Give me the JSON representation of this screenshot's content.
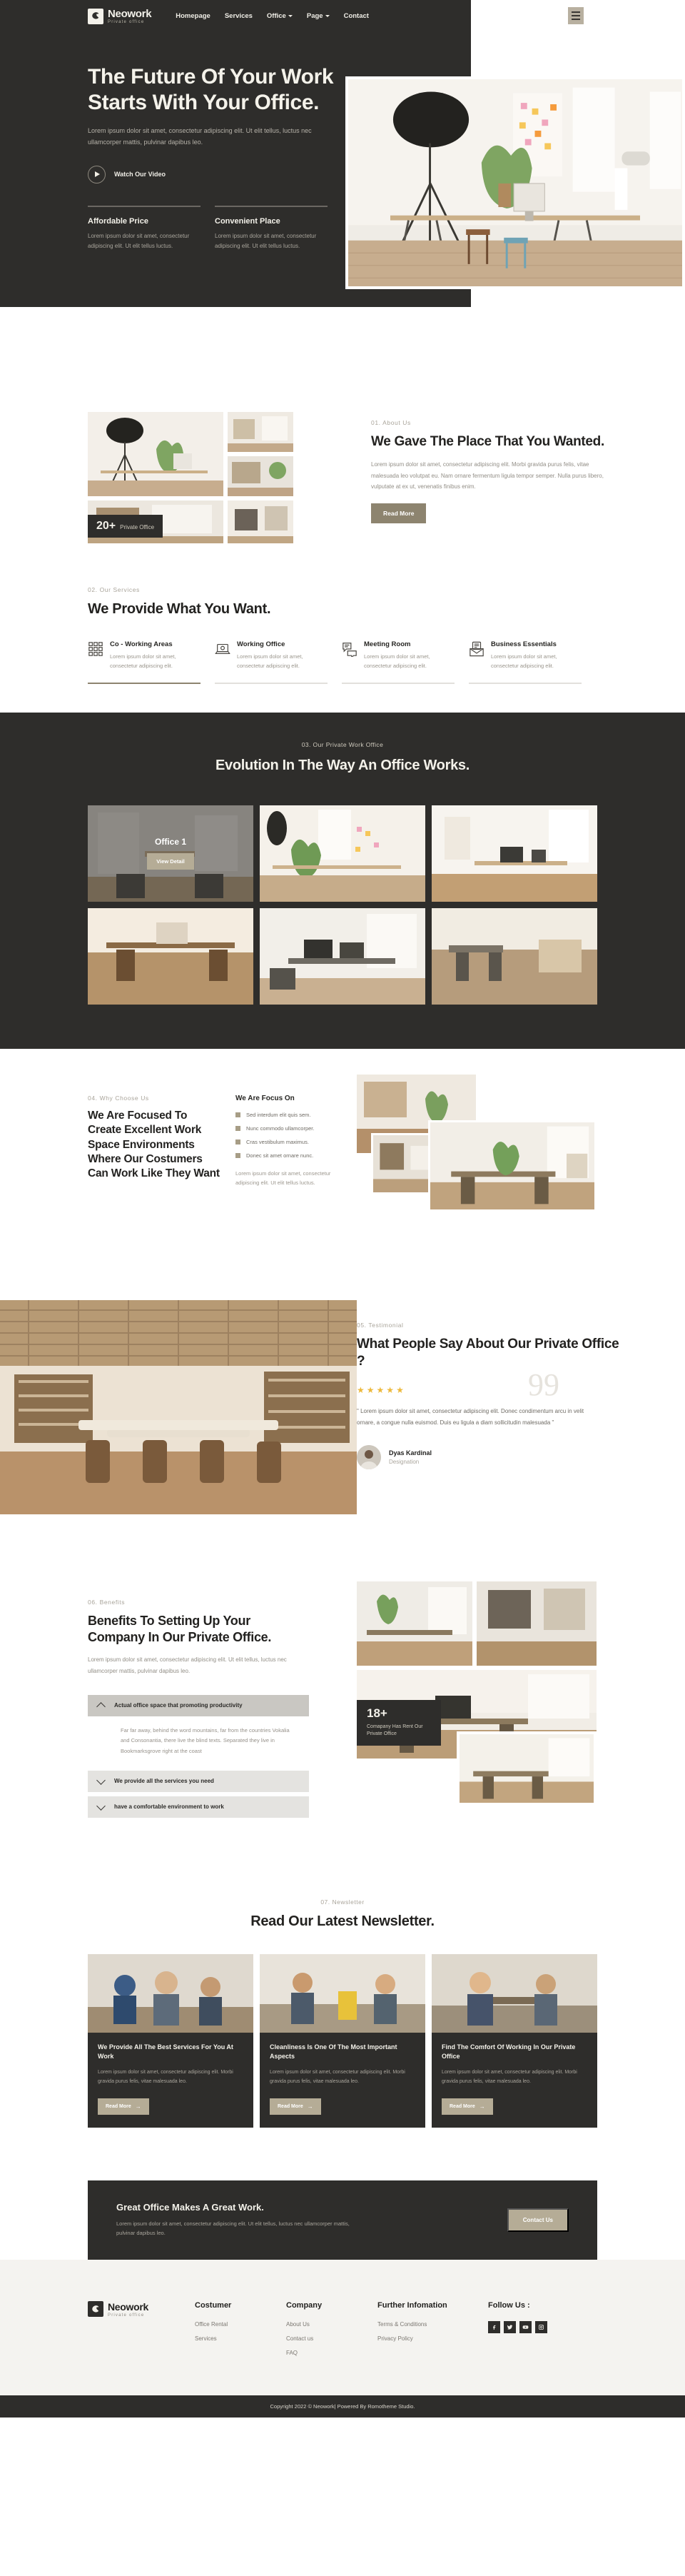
{
  "brand": {
    "name": "Neowork",
    "tagline": "Private office"
  },
  "nav": {
    "items": [
      {
        "label": "Homepage",
        "caret": false
      },
      {
        "label": "Services",
        "caret": false
      },
      {
        "label": "Office",
        "caret": true
      },
      {
        "label": "Page",
        "caret": true
      },
      {
        "label": "Contact",
        "caret": false
      }
    ],
    "menu_icon": "hamburger-icon"
  },
  "hero": {
    "heading_line1": "The Future Of Your Work",
    "heading_line2": "Starts With Your Office.",
    "paragraph": "Lorem ipsum dolor sit amet, consectetur adipiscing elit. Ut elit tellus, luctus nec ullamcorper mattis, pulvinar dapibus leo.",
    "watch_label": "Watch Our Video",
    "features": [
      {
        "title": "Affordable Price",
        "text": "Lorem ipsum dolor sit amet, consectetur adipiscing elit. Ut elit tellus luctus."
      },
      {
        "title": "Convenient Place",
        "text": "Lorem ipsum dolor sit amet, consectetur adipiscing elit. Ut elit tellus luctus."
      }
    ]
  },
  "about": {
    "eyebrow": "01. About Us",
    "heading": "We Gave The Place That You Wanted.",
    "paragraph": "Lorem ipsum dolor sit amet, consectetur adipiscing elit. Morbi gravida purus felis, vitae malesuada leo volutpat eu. Nam ornare fermentum ligula tempor semper. Nulla purus libero, vulputate at ex ut, venenatis finibus enim.",
    "button": "Read More",
    "badge_number": "20+",
    "badge_label": "Private Office"
  },
  "services": {
    "eyebrow": "02. Our Services",
    "heading": "We Provide What You Want.",
    "items": [
      {
        "title": "Co - Working Areas",
        "text": "Lorem ipsum dolor sit amet, consectetur adipiscing elit.",
        "icon": "grid-squares-icon"
      },
      {
        "title": "Working Office",
        "text": "Lorem ipsum dolor sit amet, consectetur adipiscing elit.",
        "icon": "laptop-icon"
      },
      {
        "title": "Meeting Room",
        "text": "Lorem ipsum dolor sit amet, consectetur adipiscing elit.",
        "icon": "chat-bubbles-icon"
      },
      {
        "title": "Business Essentials",
        "text": "Lorem ipsum dolor sit amet, consectetur adipiscing elit.",
        "icon": "envelope-icon"
      }
    ]
  },
  "gallery": {
    "eyebrow": "03. Our Private Work Office",
    "heading": "Evolution In The Way An Office Works.",
    "active_title": "Office 1",
    "active_button": "View Detail"
  },
  "why": {
    "eyebrow": "04. Why Choose Us",
    "heading": "We Are Focused To Create Excellent Work Space Environments Where Our Costumers Can Work Like They Want",
    "focus_title": "We Are Focus On",
    "focus_items": [
      "Sed interdum elit quis sem.",
      "Nunc commodo ullamcorper.",
      "Cras vestibulum maximus.",
      "Donec sit amet ornare nunc."
    ],
    "note": "Lorem ipsum dolor sit amet, consectetur adipiscing elit. Ut elit tellus luctus."
  },
  "testimonial": {
    "eyebrow": "05. Testimonial",
    "heading": "What People Say About Our Private Office ?",
    "rating": 5,
    "quote": "\" Lorem ipsum dolor sit amet, consectetur adipiscing elit. Donec condimentum arcu in velit ornare, a congue nulla euismod. Duis eu ligula a diam sollicitudin malesuada \"",
    "author_name": "Dyas Kardinal",
    "author_role": "Designation",
    "quote_mark": "99"
  },
  "benefits": {
    "eyebrow": "06. Benefits",
    "heading": "Benefits To Setting Up Your Company In Our Private Office.",
    "paragraph": "Lorem ipsum dolor sit amet, consectetur adipiscing elit. Ut elit tellus, luctus nec ullamcorper mattis, pulvinar dapibus leo.",
    "accordion": [
      {
        "title": "Actual office space that promoting productivity",
        "open": true,
        "body": "Far far away, behind the word mountains, far from the countries Vokalia and Consonantia, there live the blind texts. Separated they live in Bookmarksgrove right at the coast"
      },
      {
        "title": "We provide all the services you need",
        "open": false,
        "body": ""
      },
      {
        "title": "have a comfortable environment to work",
        "open": false,
        "body": ""
      }
    ],
    "badge_number": "18+",
    "badge_label": "Comapany Has Rent Our Private Office"
  },
  "newsletter": {
    "eyebrow": "07. Newsletter",
    "heading": "Read Our Latest Newsletter.",
    "cards": [
      {
        "title": "We Provide All The Best Services For You At Work",
        "text": "Lorem ipsum dolor sit amet, consectetur adipiscing elit. Morbi gravida purus felis, vitae malesuada leo.",
        "button": "Read More"
      },
      {
        "title": "Cleanliness Is One Of The Most Important Aspects",
        "text": "Lorem ipsum dolor sit amet, consectetur adipiscing elit. Morbi gravida purus felis, vitae malesuada leo.",
        "button": "Read More"
      },
      {
        "title": "Find The Comfort Of Working In Our Private Office",
        "text": "Lorem ipsum dolor sit amet, consectetur adipiscing elit. Morbi gravida purus felis, vitae malesuada leo.",
        "button": "Read More"
      }
    ]
  },
  "cta": {
    "heading": "Great Office Makes A Great Work.",
    "paragraph": "Lorem ipsum dolor sit amet, consectetur adipiscing elit. Ut elit tellus, luctus nec ullamcorper mattis, pulvinar dapibus leo.",
    "button": "Contact Us"
  },
  "footer": {
    "columns": [
      {
        "title": "Costumer",
        "links": [
          "Office Rental",
          "Services"
        ]
      },
      {
        "title": "Company",
        "links": [
          "About Us",
          "Contact us",
          "FAQ"
        ]
      },
      {
        "title": "Further Infomation",
        "links": [
          "Terms & Conditions",
          "Privacy Policy"
        ]
      }
    ],
    "follow_title": "Follow Us :",
    "socials": [
      "facebook-icon",
      "twitter-icon",
      "youtube-icon",
      "instagram-icon"
    ],
    "copyright": "Copyright 2022 © Neowork| Powered By Romotheme Studio."
  },
  "colors": {
    "dark": "#2e2d2b",
    "accent": "#b5ac96",
    "accent_dark": "#8d846f",
    "cream": "#f4f2ea"
  }
}
